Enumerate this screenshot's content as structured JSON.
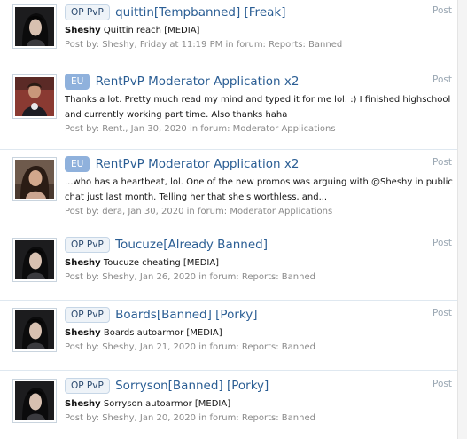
{
  "results": [
    {
      "prefix": "OP PvP",
      "prefix_style": "op",
      "title": "quittin[Tempbanned] [Freak]",
      "kind": "Post",
      "snippet_bold": "Sheshy",
      "snippet_text": " Quittin reach [MEDIA]",
      "snippet_text2": "",
      "meta_posted_by": "Post by:",
      "meta_author": "Sheshy",
      "meta_date": "Friday at 11:19 PM",
      "meta_in_forum": "in forum:",
      "meta_forum": "Reports: Banned",
      "avatar": "sheshy"
    },
    {
      "prefix": "EU",
      "prefix_style": "eu",
      "title": "RentPvP Moderator Application x2",
      "kind": "Post",
      "snippet_bold": "",
      "snippet_text": "Thanks a lot. Pretty much read my mind and typed it for me lol. :) I finished highschool",
      "snippet_text2": "and currently working part time. Also thanks haha",
      "meta_posted_by": "Post by:",
      "meta_author": "Rent.",
      "meta_date": "Jan 30, 2020",
      "meta_in_forum": "in forum:",
      "meta_forum": "Moderator Applications",
      "avatar": "rent"
    },
    {
      "prefix": "EU",
      "prefix_style": "eu",
      "title": "RentPvP Moderator Application x2",
      "kind": "Post",
      "snippet_bold": "",
      "snippet_text": "...who has a heartbeat, lol. One of the new promos was arguing with @Sheshy in public",
      "snippet_text2": "chat just last month. Telling her that she's worthless, and...",
      "meta_posted_by": "Post by:",
      "meta_author": "dera",
      "meta_date": "Jan 30, 2020",
      "meta_in_forum": "in forum:",
      "meta_forum": "Moderator Applications",
      "avatar": "dera"
    },
    {
      "prefix": "OP PvP",
      "prefix_style": "op",
      "title": "Toucuze[Already Banned]",
      "kind": "Post",
      "snippet_bold": "Sheshy",
      "snippet_text": " Toucuze cheating [MEDIA]",
      "snippet_text2": "",
      "meta_posted_by": "Post by:",
      "meta_author": "Sheshy",
      "meta_date": "Jan 26, 2020",
      "meta_in_forum": "in forum:",
      "meta_forum": "Reports: Banned",
      "avatar": "sheshy"
    },
    {
      "prefix": "OP PvP",
      "prefix_style": "op",
      "title": "Boards[Banned] [Porky]",
      "kind": "Post",
      "snippet_bold": "Sheshy",
      "snippet_text": " Boards autoarmor [MEDIA]",
      "snippet_text2": "",
      "meta_posted_by": "Post by:",
      "meta_author": "Sheshy",
      "meta_date": "Jan 21, 2020",
      "meta_in_forum": "in forum:",
      "meta_forum": "Reports: Banned",
      "avatar": "sheshy"
    },
    {
      "prefix": "OP PvP",
      "prefix_style": "op",
      "title": "Sorryson[Banned] [Porky]",
      "kind": "Post",
      "snippet_bold": "Sheshy",
      "snippet_text": " Sorryson autoarmor [MEDIA]",
      "snippet_text2": "",
      "meta_posted_by": "Post by:",
      "meta_author": "Sheshy",
      "meta_date": "Jan 20, 2020",
      "meta_in_forum": "in forum:",
      "meta_forum": "Reports: Banned",
      "avatar": "sheshy"
    }
  ],
  "colors": {
    "link": "#2b5e94",
    "meta": "#8a8a8a",
    "divider": "#dfe8f0",
    "prefix_eu": "#8fb1dc",
    "prefix_op_bg": "#eef3f8"
  }
}
